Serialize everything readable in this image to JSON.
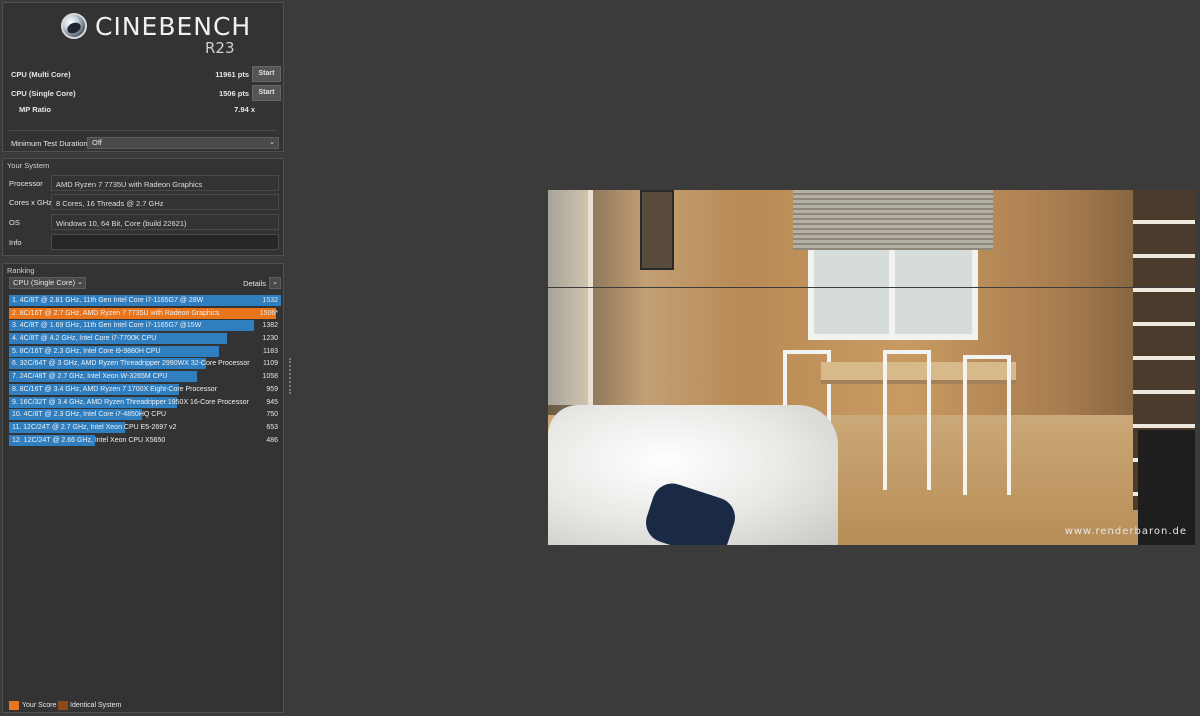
{
  "app": {
    "title": "CINEBENCH",
    "version": "R23"
  },
  "scores": {
    "multi_label": "CPU (Multi Core)",
    "multi_value": "11961 pts",
    "single_label": "CPU (Single Core)",
    "single_value": "1506 pts",
    "start_label": "Start",
    "mp_label": "MP Ratio",
    "mp_value": "7.94 x"
  },
  "min_test": {
    "label": "Minimum Test Duration",
    "value": "Off"
  },
  "system": {
    "title": "Your System",
    "rows": [
      {
        "label": "Processor",
        "value": "AMD Ryzen 7 7735U with Radeon Graphics"
      },
      {
        "label": "Cores x GHz",
        "value": "8 Cores, 16 Threads @ 2.7 GHz"
      },
      {
        "label": "OS",
        "value": "Windows 10, 64 Bit, Core (build 22621)"
      },
      {
        "label": "Info",
        "value": ""
      }
    ]
  },
  "ranking": {
    "title": "Ranking",
    "selected": "CPU (Single Core)",
    "details_label": "Details",
    "max_score": 1532,
    "items": [
      {
        "name": "1. 4C/8T @ 2.81 GHz, 11th Gen Intel Core i7-1165G7 @ 28W",
        "score": "1532",
        "value": 1532,
        "mine": false
      },
      {
        "name": "2. 8C/16T @ 2.7 GHz, AMD Ryzen 7 7735U with Radeon Graphics",
        "score": "1506*",
        "value": 1506,
        "mine": true
      },
      {
        "name": "3. 4C/8T @ 1.69 GHz, 11th Gen Intel Core i7-1165G7 @15W",
        "score": "1382",
        "value": 1382,
        "mine": false
      },
      {
        "name": "4. 4C/8T @ 4.2 GHz, Intel Core i7-7700K CPU",
        "score": "1230",
        "value": 1230,
        "mine": false
      },
      {
        "name": "5. 8C/16T @ 2.3 GHz, Intel Core i9-9880H CPU",
        "score": "1183",
        "value": 1183,
        "mine": false
      },
      {
        "name": "6. 32C/64T @ 3 GHz, AMD Ryzen Threadripper 2990WX 32-Core Processor",
        "score": "1109",
        "value": 1109,
        "mine": false
      },
      {
        "name": "7. 24C/48T @ 2.7 GHz, Intel Xeon W-3265M CPU",
        "score": "1058",
        "value": 1058,
        "mine": false
      },
      {
        "name": "8. 8C/16T @ 3.4 GHz, AMD Ryzen 7 1700X Eight-Core Processor",
        "score": "959",
        "value": 959,
        "mine": false
      },
      {
        "name": "9. 16C/32T @ 3.4 GHz, AMD Ryzen Threadripper 1950X 16-Core Processor",
        "score": "945",
        "value": 945,
        "mine": false
      },
      {
        "name": "10. 4C/8T @ 2.3 GHz, Intel Core i7-4850HQ CPU",
        "score": "750",
        "value": 750,
        "mine": false
      },
      {
        "name": "11. 12C/24T @ 2.7 GHz, Intel Xeon CPU E5-2697 v2",
        "score": "653",
        "value": 653,
        "mine": false
      },
      {
        "name": "12. 12C/24T @ 2.66 GHz, Intel Xeon CPU X5650",
        "score": "486",
        "value": 486,
        "mine": false
      }
    ]
  },
  "legend": {
    "your_score": "Your Score",
    "identical": "Identical System",
    "your_color": "#e8741b",
    "identical_color": "#8a4a1a"
  },
  "render": {
    "watermark": "www.renderbaron.de"
  }
}
